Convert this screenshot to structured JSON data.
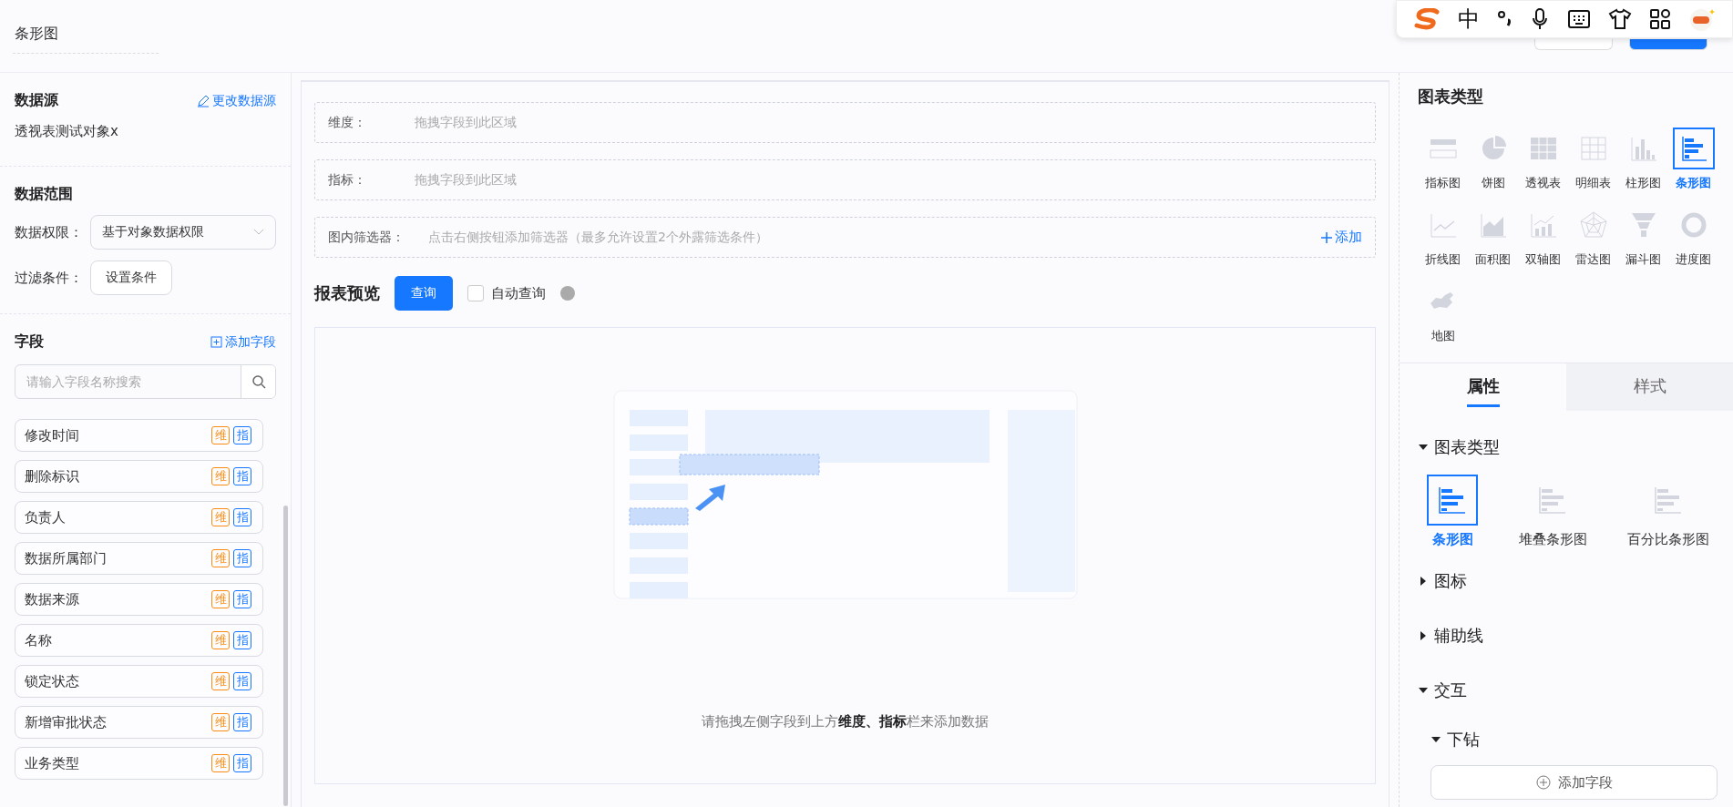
{
  "header": {
    "title": "条形图"
  },
  "ime_toolbar": {
    "mode": "中"
  },
  "data_source": {
    "title": "数据源",
    "link": "更改数据源",
    "value": "透视表测试对象x"
  },
  "data_range": {
    "title": "数据范围",
    "permission_label": "数据权限：",
    "permission_value": "基于对象数据权限",
    "filter_label": "过滤条件：",
    "filter_button": "设置条件"
  },
  "fields": {
    "title": "字段",
    "add": "添加字段",
    "search_placeholder": "请输入字段名称搜索",
    "items": [
      {
        "name": "修改时间",
        "tags": [
          {
            "label": "维",
            "kind": "dimension"
          },
          {
            "label": "指",
            "kind": "measure"
          }
        ]
      },
      {
        "name": "删除标识",
        "tags": [
          {
            "label": "维",
            "kind": "dimension"
          },
          {
            "label": "指",
            "kind": "measure"
          }
        ]
      },
      {
        "name": "负责人",
        "tags": [
          {
            "label": "维",
            "kind": "dimension"
          },
          {
            "label": "指",
            "kind": "measure"
          }
        ]
      },
      {
        "name": "数据所属部门",
        "tags": [
          {
            "label": "维",
            "kind": "dimension"
          },
          {
            "label": "指",
            "kind": "measure"
          }
        ]
      },
      {
        "name": "数据来源",
        "tags": [
          {
            "label": "维",
            "kind": "dimension"
          },
          {
            "label": "指",
            "kind": "measure"
          }
        ]
      },
      {
        "name": "名称",
        "tags": [
          {
            "label": "维",
            "kind": "dimension"
          },
          {
            "label": "指",
            "kind": "measure"
          }
        ]
      },
      {
        "name": "锁定状态",
        "tags": [
          {
            "label": "维",
            "kind": "dimension"
          },
          {
            "label": "指",
            "kind": "measure"
          }
        ]
      },
      {
        "name": "新增审批状态",
        "tags": [
          {
            "label": "维",
            "kind": "dimension"
          },
          {
            "label": "指",
            "kind": "measure"
          }
        ]
      },
      {
        "name": "业务类型",
        "tags": [
          {
            "label": "维",
            "kind": "dimension"
          },
          {
            "label": "指",
            "kind": "measure"
          }
        ]
      }
    ]
  },
  "drop_zones": [
    {
      "label": "维度：",
      "placeholder": "拖拽字段到此区域"
    },
    {
      "label": "指标：",
      "placeholder": "拖拽字段到此区域"
    },
    {
      "label": "图内筛选器：",
      "placeholder": "点击右侧按钮添加筛选器（最多允许设置2个外露筛选条件）",
      "action": "添加"
    }
  ],
  "preview": {
    "title": "报表预览",
    "query_button": "查询",
    "auto_query": {
      "label": "自动查询",
      "checked": false
    },
    "empty_text": "请拖拽左侧字段到上方**维度、指标**栏来添加数据"
  },
  "chart_types": {
    "title": "图表类型",
    "items": [
      {
        "label": "指标图",
        "kind": "kpi",
        "selected": false
      },
      {
        "label": "饼图",
        "kind": "pie",
        "selected": false
      },
      {
        "label": "透视表",
        "kind": "pivot",
        "selected": false
      },
      {
        "label": "明细表",
        "kind": "detail",
        "selected": false
      },
      {
        "label": "柱形图",
        "kind": "column",
        "selected": false
      },
      {
        "label": "条形图",
        "kind": "bar",
        "selected": true
      },
      {
        "label": "折线图",
        "kind": "line",
        "selected": false
      },
      {
        "label": "面积图",
        "kind": "area",
        "selected": false
      },
      {
        "label": "双轴图",
        "kind": "dual",
        "selected": false
      },
      {
        "label": "雷达图",
        "kind": "radar",
        "selected": false
      },
      {
        "label": "漏斗图",
        "kind": "funnel",
        "selected": false
      },
      {
        "label": "进度图",
        "kind": "progress",
        "selected": false
      },
      {
        "label": "地图",
        "kind": "map",
        "selected": false
      }
    ]
  },
  "tabs": [
    {
      "label": "属性",
      "selected": true
    },
    {
      "label": "样式",
      "selected": false
    }
  ],
  "sections": [
    {
      "title": "图表类型",
      "expanded": true,
      "subtypes": [
        {
          "label": "条形图",
          "selected": true
        },
        {
          "label": "堆叠条形图",
          "selected": false
        },
        {
          "label": "百分比条形图",
          "selected": false
        }
      ]
    },
    {
      "title": "图标",
      "expanded": false
    },
    {
      "title": "辅助线",
      "expanded": false
    },
    {
      "title": "交互",
      "expanded": true,
      "children": [
        {
          "title": "下钻",
          "expanded": true,
          "button": "添加字段"
        }
      ]
    }
  ]
}
